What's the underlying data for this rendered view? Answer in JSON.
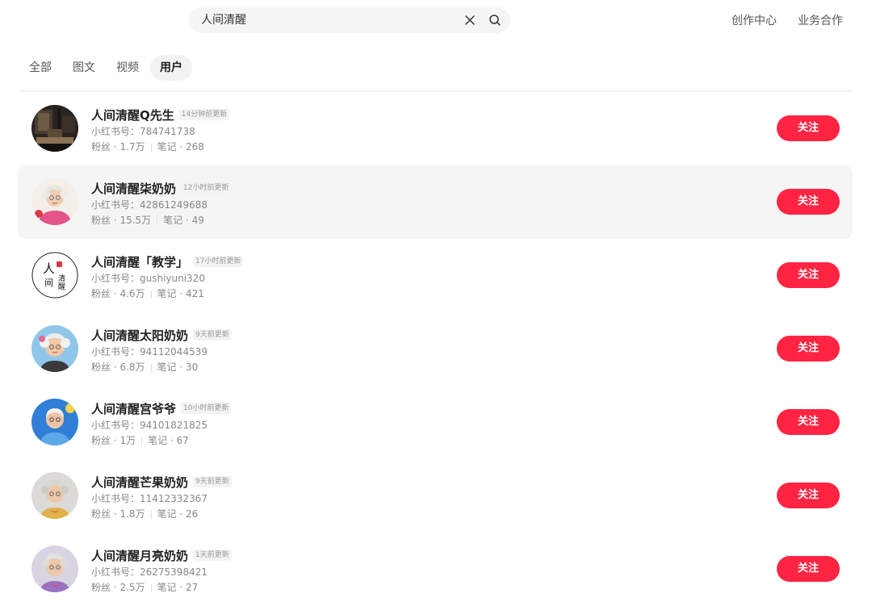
{
  "search": {
    "query": "人间清醒"
  },
  "top_links": [
    "创作中心",
    "业务合作"
  ],
  "tabs": [
    {
      "label": "全部",
      "active": false
    },
    {
      "label": "图文",
      "active": false
    },
    {
      "label": "视频",
      "active": false
    },
    {
      "label": "用户",
      "active": true
    }
  ],
  "icons": {
    "clear": "close-icon",
    "search": "search-icon"
  },
  "colors": {
    "accent": "#ff2442",
    "hover_row": "#f5f5f5"
  },
  "users": [
    {
      "name": "人间清醒Q先生",
      "updated": "14分钟前更新",
      "id_label": "小红书号：784741738",
      "fans": "粉丝 · 1.7万",
      "notes": "笔记 · 268",
      "follow_label": "关注",
      "avatar": "dark-room-photo",
      "hovered": false
    },
    {
      "name": "人间清醒柒奶奶",
      "updated": "12小时前更新",
      "id_label": "小红书号：42861249688",
      "fans": "粉丝 · 15.5万",
      "notes": "笔记 · 49",
      "follow_label": "关注",
      "avatar": "grandma-pink",
      "hovered": true
    },
    {
      "name": "人间清醒「教学」",
      "updated": "17小时前更新",
      "id_label": "小红书号：gushiyuni320",
      "fans": "粉丝 · 4.6万",
      "notes": "笔记 · 421",
      "follow_label": "关注",
      "avatar": "calligraphy",
      "avatar_text": {
        "a": "人",
        "b": "间",
        "c": "清",
        "d": "醒"
      },
      "hovered": false
    },
    {
      "name": "人间清醒太阳奶奶",
      "updated": "9天前更新",
      "id_label": "小红书号：94112044539",
      "fans": "粉丝 · 6.8万",
      "notes": "笔记 · 30",
      "follow_label": "关注",
      "avatar": "grandma-blue",
      "hovered": false
    },
    {
      "name": "人间清醒宫爷爷",
      "updated": "10小时前更新",
      "id_label": "小红书号：94101821825",
      "fans": "粉丝 · 1万",
      "notes": "笔记 · 67",
      "follow_label": "关注",
      "avatar": "grandpa-blue",
      "hovered": false
    },
    {
      "name": "人间清醒芒果奶奶",
      "updated": "9天前更新",
      "id_label": "小红书号：11412332367",
      "fans": "粉丝 · 1.8万",
      "notes": "笔记 · 26",
      "follow_label": "关注",
      "avatar": "grandma-grey",
      "hovered": false
    },
    {
      "name": "人间清醒月亮奶奶",
      "updated": "1天前更新",
      "id_label": "小红书号：26275398421",
      "fans": "粉丝 · 2.5万",
      "notes": "笔记 · 27",
      "follow_label": "关注",
      "avatar": "grandma-purple",
      "hovered": false
    }
  ]
}
